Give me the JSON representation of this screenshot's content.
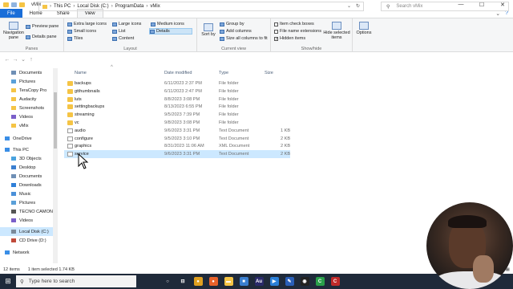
{
  "window": {
    "title": "vMix",
    "controls": [
      "—",
      "☐",
      "✕"
    ]
  },
  "ribbon_tabs": [
    "File",
    "Home",
    "Share",
    "View"
  ],
  "ribbon": {
    "panes": {
      "navigation_pane": "Navigation pane",
      "preview_pane": "Preview pane",
      "details_pane": "Details pane",
      "label": "Panes"
    },
    "layout": {
      "items": [
        "Extra large icons",
        "Large icons",
        "Medium icons",
        "Small icons",
        "List",
        "Details",
        "Tiles",
        "Content"
      ],
      "active": "Details",
      "label": "Layout"
    },
    "current_view": {
      "sort_by": "Sort by",
      "group_by": "Group by",
      "add_columns": "Add columns",
      "size_all_columns": "Size all columns to fit",
      "label": "Current view"
    },
    "show_hide": {
      "item_check_boxes": "Item check boxes",
      "item_check_boxes_checked": false,
      "file_name_extensions": "File name extensions",
      "file_name_extensions_checked": false,
      "hidden_items": "Hidden items",
      "hidden_items_checked": true,
      "hide_selected": "Hide selected items",
      "label": "Show/hide"
    },
    "options": "Options"
  },
  "address": {
    "crumbs": [
      "This PC",
      "Local Disk (C:)",
      "ProgramData",
      "vMix"
    ],
    "search_placeholder": "Search vMix"
  },
  "nav_pane": {
    "items": [
      {
        "label": "Documents",
        "icon": "documents-icon",
        "color": "#6f8fb5",
        "indent": 1
      },
      {
        "label": "Pictures",
        "icon": "pictures-icon",
        "color": "#5aa0d8",
        "indent": 1
      },
      {
        "label": "TeraCopy Pro",
        "icon": "folder-icon",
        "color": "#f5c445",
        "indent": 1
      },
      {
        "label": "Audacity",
        "icon": "folder-icon",
        "color": "#f5c445",
        "indent": 1
      },
      {
        "label": "Screenshots",
        "icon": "folder-icon",
        "color": "#f5c445",
        "indent": 1
      },
      {
        "label": "Videos",
        "icon": "videos-icon",
        "color": "#7a5fc9",
        "indent": 1
      },
      {
        "label": "vMix",
        "icon": "folder-icon",
        "color": "#f5c445",
        "indent": 1
      },
      {
        "label": "OneDrive",
        "icon": "onedrive-icon",
        "color": "#3a8ee6",
        "indent": 0
      },
      {
        "label": "This PC",
        "icon": "this-pc-icon",
        "color": "#3a8ee6",
        "indent": 0
      },
      {
        "label": "3D Objects",
        "icon": "3d-objects-icon",
        "color": "#4aa3df",
        "indent": 1
      },
      {
        "label": "Desktop",
        "icon": "desktop-icon",
        "color": "#3a7fd0",
        "indent": 1
      },
      {
        "label": "Documents",
        "icon": "documents-icon",
        "color": "#6f8fb5",
        "indent": 1
      },
      {
        "label": "Downloads",
        "icon": "downloads-icon",
        "color": "#2f7fd8",
        "indent": 1
      },
      {
        "label": "Music",
        "icon": "music-icon",
        "color": "#4a90d9",
        "indent": 1
      },
      {
        "label": "Pictures",
        "icon": "pictures-icon",
        "color": "#5aa0d8",
        "indent": 1
      },
      {
        "label": "TECNO CAMON",
        "icon": "phone-icon",
        "color": "#555555",
        "indent": 1
      },
      {
        "label": "Videos",
        "icon": "videos-icon",
        "color": "#7a5fc9",
        "indent": 1
      },
      {
        "label": "Local Disk (C:)",
        "icon": "drive-icon",
        "color": "#7a8a9a",
        "indent": 1,
        "selected": true
      },
      {
        "label": "CD Drive (D:)",
        "icon": "cd-drive-icon",
        "color": "#c04a3a",
        "indent": 1
      },
      {
        "label": "Network",
        "icon": "network-icon",
        "color": "#3a8ee6",
        "indent": 0
      }
    ]
  },
  "columns": {
    "name": "Name",
    "date": "Date modified",
    "type": "Type",
    "size": "Size"
  },
  "files": [
    {
      "name": "backups",
      "date": "6/11/2023 2:37 PM",
      "type": "File folder",
      "size": "",
      "kind": "folder"
    },
    {
      "name": "gtthumbnails",
      "date": "6/11/2023 2:47 PM",
      "type": "File folder",
      "size": "",
      "kind": "folder"
    },
    {
      "name": "luts",
      "date": "8/8/2023 3:08 PM",
      "type": "File folder",
      "size": "",
      "kind": "folder"
    },
    {
      "name": "settingbackups",
      "date": "8/13/2023 6:55 PM",
      "type": "File folder",
      "size": "",
      "kind": "folder"
    },
    {
      "name": "streaming",
      "date": "9/5/2023 7:39 PM",
      "type": "File folder",
      "size": "",
      "kind": "folder"
    },
    {
      "name": "vc",
      "date": "9/8/2023 3:08 PM",
      "type": "File folder",
      "size": "",
      "kind": "folder"
    },
    {
      "name": "audio",
      "date": "9/6/2023 3:31 PM",
      "type": "Text Document",
      "size": "1 KB",
      "kind": "doc"
    },
    {
      "name": "configure",
      "date": "9/5/2023 3:10 PM",
      "type": "Text Document",
      "size": "2 KB",
      "kind": "doc"
    },
    {
      "name": "graphics",
      "date": "8/31/2023 11:06 AM",
      "type": "XML Document",
      "size": "2 KB",
      "kind": "doc"
    },
    {
      "name": "service",
      "date": "9/6/2023 3:31 PM",
      "type": "Text Document",
      "size": "2 KB",
      "kind": "doc",
      "selected": true
    }
  ],
  "status": {
    "item_count": "12 items",
    "selection": "1 item selected  1.74 KB"
  },
  "taskbar": {
    "search_placeholder": "Type here to search",
    "apps": [
      {
        "icon": "task-view-icon",
        "color": "#1f2a3a",
        "glyph": "○"
      },
      {
        "icon": "multitask-icon",
        "color": "#1f2a3a",
        "glyph": "⊟"
      },
      {
        "icon": "chrome-icon",
        "color": "#e0a020",
        "glyph": "●"
      },
      {
        "icon": "firefox-icon",
        "color": "#e8622a",
        "glyph": "●"
      },
      {
        "icon": "file-explorer-icon",
        "color": "#f5c445",
        "glyph": "▬"
      },
      {
        "icon": "store-icon",
        "color": "#3a7fd0",
        "glyph": "■"
      },
      {
        "icon": "audition-icon",
        "color": "#2a2a6a",
        "glyph": "Au"
      },
      {
        "icon": "media-player-icon",
        "color": "#2a7fd8",
        "glyph": "▶"
      },
      {
        "icon": "editor-icon",
        "color": "#2a5fb8",
        "glyph": "✎"
      },
      {
        "icon": "obs-icon",
        "color": "#222222",
        "glyph": "◉"
      },
      {
        "icon": "camtasia-icon",
        "color": "#2aa04a",
        "glyph": "C"
      },
      {
        "icon": "capcut-icon",
        "color": "#c02a2a",
        "glyph": "C"
      }
    ]
  }
}
